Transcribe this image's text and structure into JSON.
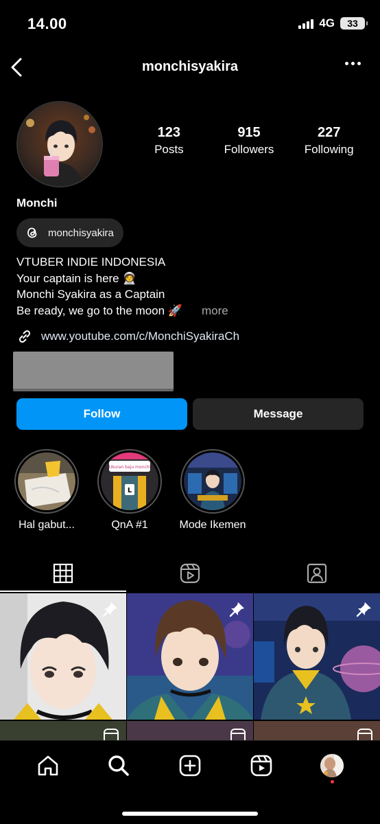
{
  "status_bar": {
    "time": "14.00",
    "network": "4G",
    "battery": "33"
  },
  "header": {
    "username": "monchisyakira"
  },
  "profile": {
    "display_name": "Monchi",
    "stats": [
      {
        "value": "123",
        "label": "Posts"
      },
      {
        "value": "915",
        "label": "Followers"
      },
      {
        "value": "227",
        "label": "Following"
      }
    ],
    "threads_handle": "monchisyakira",
    "bio": [
      "VTUBER INDIE INDONESIA",
      "Your captain is here 🧑‍🚀",
      "Monchi Syakira as a Captain",
      "Be ready, we go to the moon 🚀"
    ],
    "bio_more": "more",
    "link": "www.youtube.com/c/MonchiSyakiraCh"
  },
  "actions": {
    "follow": "Follow",
    "message": "Message"
  },
  "highlights": [
    {
      "label": "Hal gabut..."
    },
    {
      "label": "QnA #1"
    },
    {
      "label": "Mode Ikemen"
    }
  ],
  "highlight_content": {
    "qna_card_text": "Ukuran baju monchi",
    "qna_size": "L"
  },
  "tabs": [
    {
      "icon": "grid-icon"
    },
    {
      "icon": "reels-icon"
    },
    {
      "icon": "tagged-icon"
    }
  ],
  "posts": [
    {
      "pinned": true,
      "icon": "pin-icon"
    },
    {
      "pinned": true,
      "icon": "pin-icon"
    },
    {
      "pinned": true,
      "icon": "pin-icon"
    },
    {
      "icon": "reel-icon"
    },
    {
      "icon": "reel-icon"
    },
    {
      "icon": "reel-icon"
    }
  ],
  "bottom_nav": [
    {
      "icon": "home-icon"
    },
    {
      "icon": "search-icon"
    },
    {
      "icon": "create-icon"
    },
    {
      "icon": "reels-icon"
    },
    {
      "icon": "profile-avatar"
    }
  ],
  "colors": {
    "follow_button": "#0095f6",
    "message_button": "#262626",
    "notification_dot": "#ff3040"
  }
}
